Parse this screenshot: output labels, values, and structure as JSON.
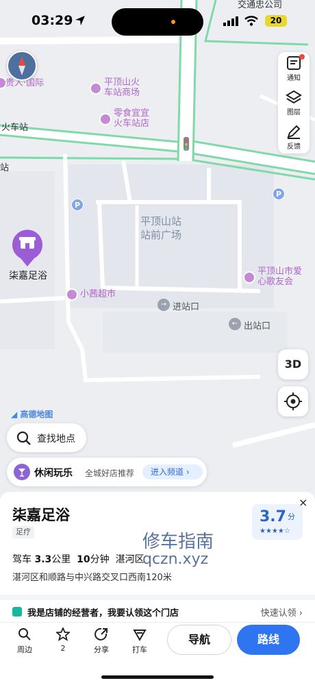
{
  "status_bar": {
    "time": "03:29",
    "battery": "20"
  },
  "map": {
    "labels": {
      "top_right_label": "交通忠公司",
      "guiren": "贵人·国际",
      "station_mall": "平顶山火\n车站商场",
      "food_store": "零食宜宜\n火车站店",
      "train_station_left": "火车站",
      "station_edge": "站",
      "plaza": "平顶山站\n站前广场",
      "ai_xin": "平顶山市爱\n心歌友会",
      "supermarket": "小茜超市",
      "entrance": "进站口",
      "exit": "出站口",
      "pin_name": "柒嘉足浴"
    },
    "parking_label": "P"
  },
  "tools": {
    "notice": "通知",
    "layers": "图层",
    "feedback": "反馈"
  },
  "btn_3d": "3D",
  "logo_text": "高德地图",
  "search": {
    "placeholder": "查找地点"
  },
  "leisure": {
    "title": "休闲玩乐",
    "subtitle": "全城好店推荐",
    "action": "进入频道 ›"
  },
  "sheet": {
    "close": "×",
    "name": "柒嘉足浴",
    "tag": "足疗",
    "rating": "3.7",
    "rating_unit": "分",
    "stars": "★★★★☆",
    "drive_prefix": "驾车",
    "distance": "3.3",
    "distance_unit": "公里",
    "duration": "10",
    "duration_unit": "分钟",
    "district": "湛河区",
    "address": "湛河区和顺路与中兴路交叉口西南120米",
    "watermark_line1": "修车指南",
    "watermark_line2": "qczn.xyz",
    "owner_text": "我是店铺的经营者，我要认领这个门店",
    "owner_action": "快速认领 ›"
  },
  "bottom_bar": {
    "nearby": "周边",
    "favorite_count": "2",
    "share": "分享",
    "taxi": "打车",
    "navigate": "导航",
    "route": "路线"
  },
  "colors": {
    "accent": "#2f74f0",
    "road_green": "#7fd9a8",
    "poi_purple": "#b066c8",
    "pin_purple": "#9b5cd6"
  }
}
